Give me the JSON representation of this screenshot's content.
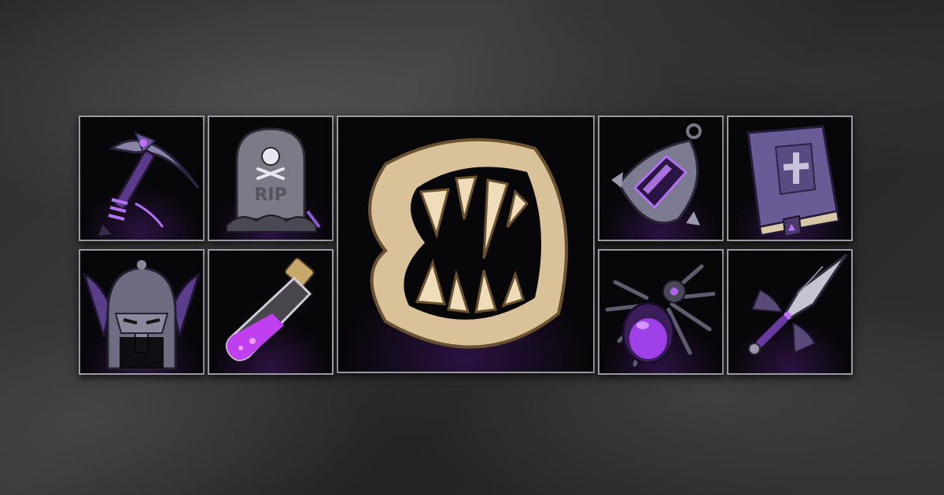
{
  "gallery": {
    "items": [
      {
        "icon": "pickaxe-icon"
      },
      {
        "icon": "tombstone-icon",
        "engraving": "RIP"
      },
      {
        "icon": "fangs-jaw-icon"
      },
      {
        "icon": "amulet-icon"
      },
      {
        "icon": "spellbook-icon"
      },
      {
        "icon": "bat-helmet-icon"
      },
      {
        "icon": "potion-vial-icon"
      },
      {
        "icon": "spider-icon"
      },
      {
        "icon": "dagger-icon"
      }
    ]
  },
  "colors": {
    "frame_border": "#9a9aa2",
    "tile_background": "#070608",
    "accent_purple": "#9b3fe0",
    "steel": "#8a8898",
    "bone": "#d9c29a"
  }
}
